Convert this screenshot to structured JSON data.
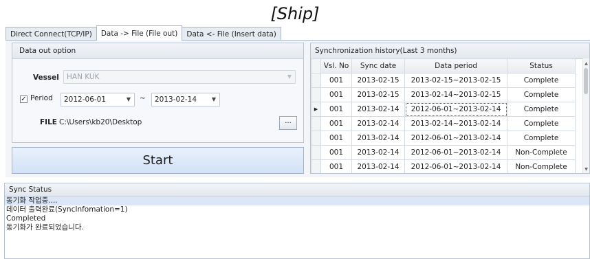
{
  "app_title": "[Ship]",
  "tabs": [
    {
      "label": "Direct Connect(TCP/IP)"
    },
    {
      "label": "Data -> File (File out)"
    },
    {
      "label": "Data <- File (Insert data)"
    }
  ],
  "data_out": {
    "title": "Data out option",
    "vessel_label": "Vessel",
    "vessel_value": "HAN KUK",
    "period_label": "Period",
    "period_checked": true,
    "period_from": "2012-06-01",
    "period_sep": "~",
    "period_to": "2013-02-14",
    "file_label": "FILE",
    "file_value": "C:\\Users\\kb20\\Desktop",
    "browse_label": "...",
    "start_label": "Start"
  },
  "history": {
    "title": "Synchronization history(Last 3 months)",
    "columns": [
      "Vsl. No",
      "Sync date",
      "Data period",
      "Status"
    ],
    "rows": [
      [
        "001",
        "2013-02-15",
        "2013-02-15~2013-02-15",
        "Complete"
      ],
      [
        "001",
        "2013-02-15",
        "2013-02-14~2013-02-15",
        "Complete"
      ],
      [
        "001",
        "2013-02-14",
        "2012-06-01~2013-02-14",
        "Complete"
      ],
      [
        "001",
        "2013-02-14",
        "2013-02-14~2013-02-14",
        "Complete"
      ],
      [
        "001",
        "2013-02-14",
        "2012-06-01~2013-02-14",
        "Complete"
      ],
      [
        "001",
        "2013-02-14",
        "2012-06-01~2013-02-14",
        "Non-Complete"
      ],
      [
        "001",
        "2013-02-14",
        "2012-06-01~2013-02-14",
        "Non-Complete"
      ]
    ],
    "selected_row": 2
  },
  "sync_status": {
    "title": "Sync Status",
    "lines": [
      "동기화 작업중....",
      "데이터 출력완료(SyncInfomation=1)",
      "Completed",
      "동기화가 완료되었습니다."
    ]
  }
}
